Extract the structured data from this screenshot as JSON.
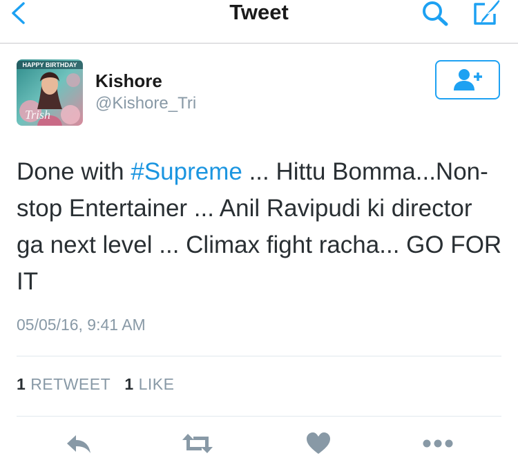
{
  "nav": {
    "title": "Tweet",
    "back_icon": "chevron-left-icon",
    "search_icon": "search-icon",
    "compose_icon": "compose-icon"
  },
  "author": {
    "display_name": "Kishore",
    "username": "@Kishore_Tri",
    "avatar_text": "HAPPY BIRTHDAY",
    "avatar_signature": "Trish"
  },
  "tweet": {
    "text_before": "Done with ",
    "hashtag": "#Supreme",
    "text_after": " ... Hittu Bomma...Non-stop Entertainer ... Anil Ravipudi ki director ga next level ... Climax fight racha... GO FOR IT",
    "timestamp": "05/05/16, 9:41 AM"
  },
  "stats": {
    "retweet_count": "1",
    "retweet_label": "RETWEET",
    "like_count": "1",
    "like_label": "LIKE"
  },
  "actions": [
    "reply-icon",
    "retweet-icon",
    "like-icon",
    "more-icon"
  ],
  "colors": {
    "accent": "#1da1f2",
    "hashtag": "#1b95e0",
    "muted": "#8899a6",
    "icon_gray": "#8899a6"
  }
}
